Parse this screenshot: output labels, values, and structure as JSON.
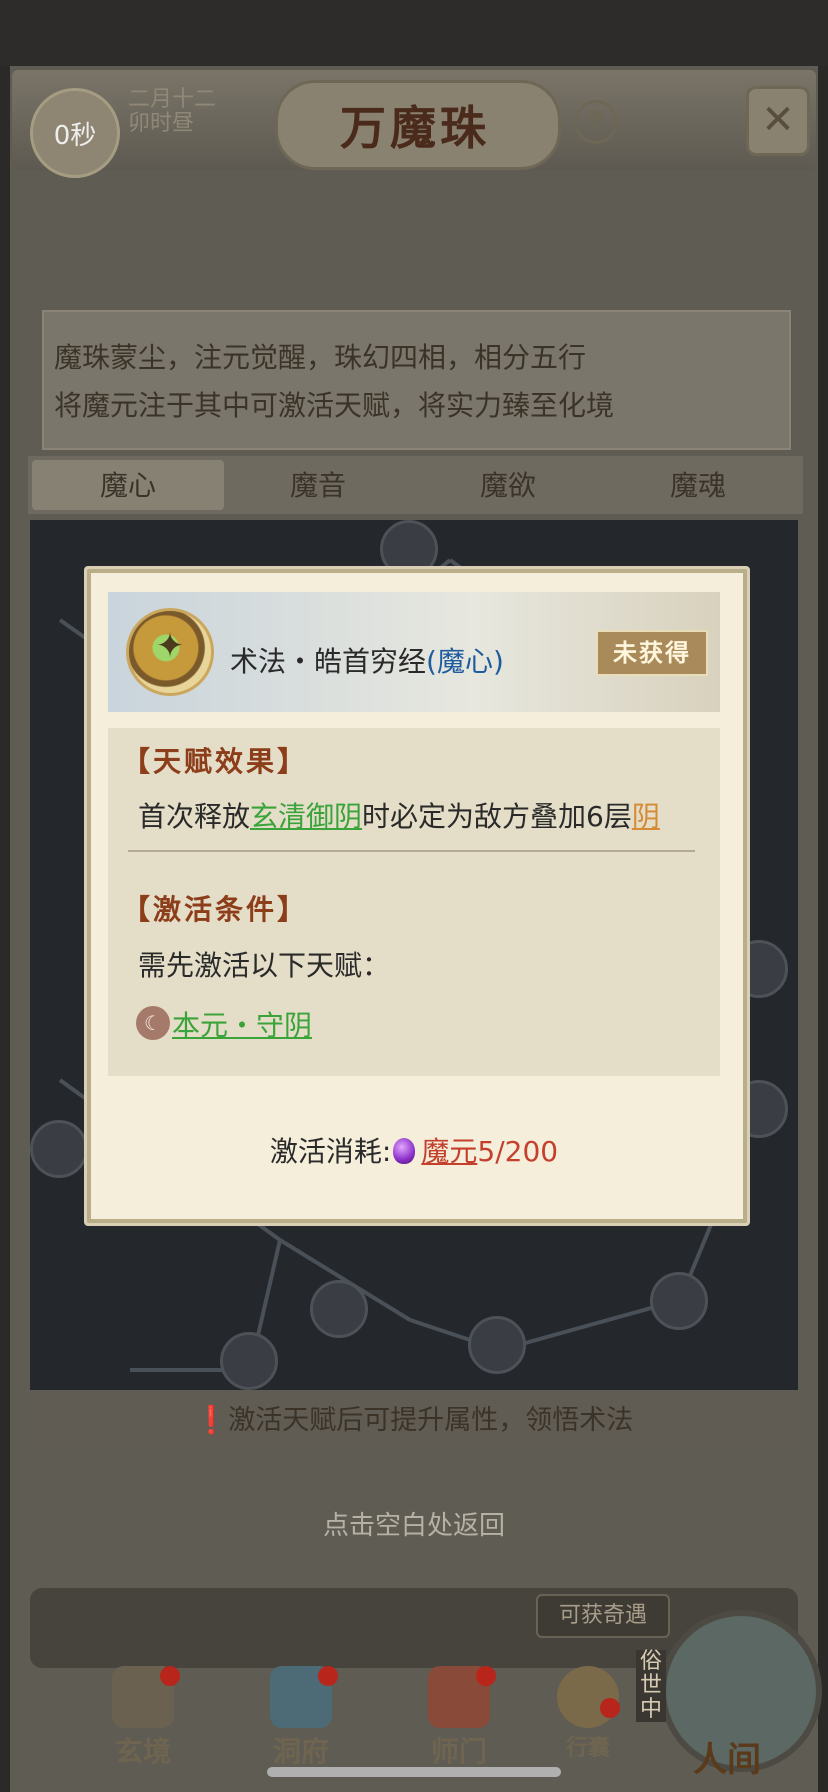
{
  "header": {
    "timer": "0秒",
    "date_line1": "二月十二",
    "date_line2": "卯时昼",
    "title": "万魔珠",
    "help": "?",
    "close": "✕"
  },
  "description": {
    "line1": "魔珠蒙尘，注元觉醒，珠幻四相，相分五行",
    "line2": "将魔元注于其中可激活天赋，将实力臻至化境"
  },
  "tabs": [
    "魔心",
    "魔音",
    "魔欲",
    "魔魂"
  ],
  "hint": "激活天赋后可提升属性，领悟术法",
  "return_text": "点击空白处返回",
  "bottom": {
    "can_get": "可获奇遇",
    "nav": [
      "玄境",
      "洞府",
      "师门",
      "行囊",
      "人间"
    ],
    "secular": "俗世中"
  },
  "modal": {
    "icon_glyph": "✦",
    "skill_name": "术法・皓首穷经",
    "skill_type": "(魔心)",
    "status": "未获得",
    "effect_title": "【天赋效果】",
    "effect_pre": "首次释放",
    "effect_link": "玄清御阴",
    "effect_mid": "时必定为敌方叠加6层",
    "effect_end": "阴",
    "req_title": "【激活条件】",
    "req_text": "需先激活以下天赋：",
    "req_link": "本元・守阴",
    "cost_label": "激活消耗:",
    "cost_resource": "魔元",
    "cost_value": "5/200"
  },
  "colors": {
    "accent_green": "#3aa33a",
    "accent_orange": "#d58a35",
    "section_title": "#8c3d1a",
    "cost_red": "#c4402c"
  }
}
